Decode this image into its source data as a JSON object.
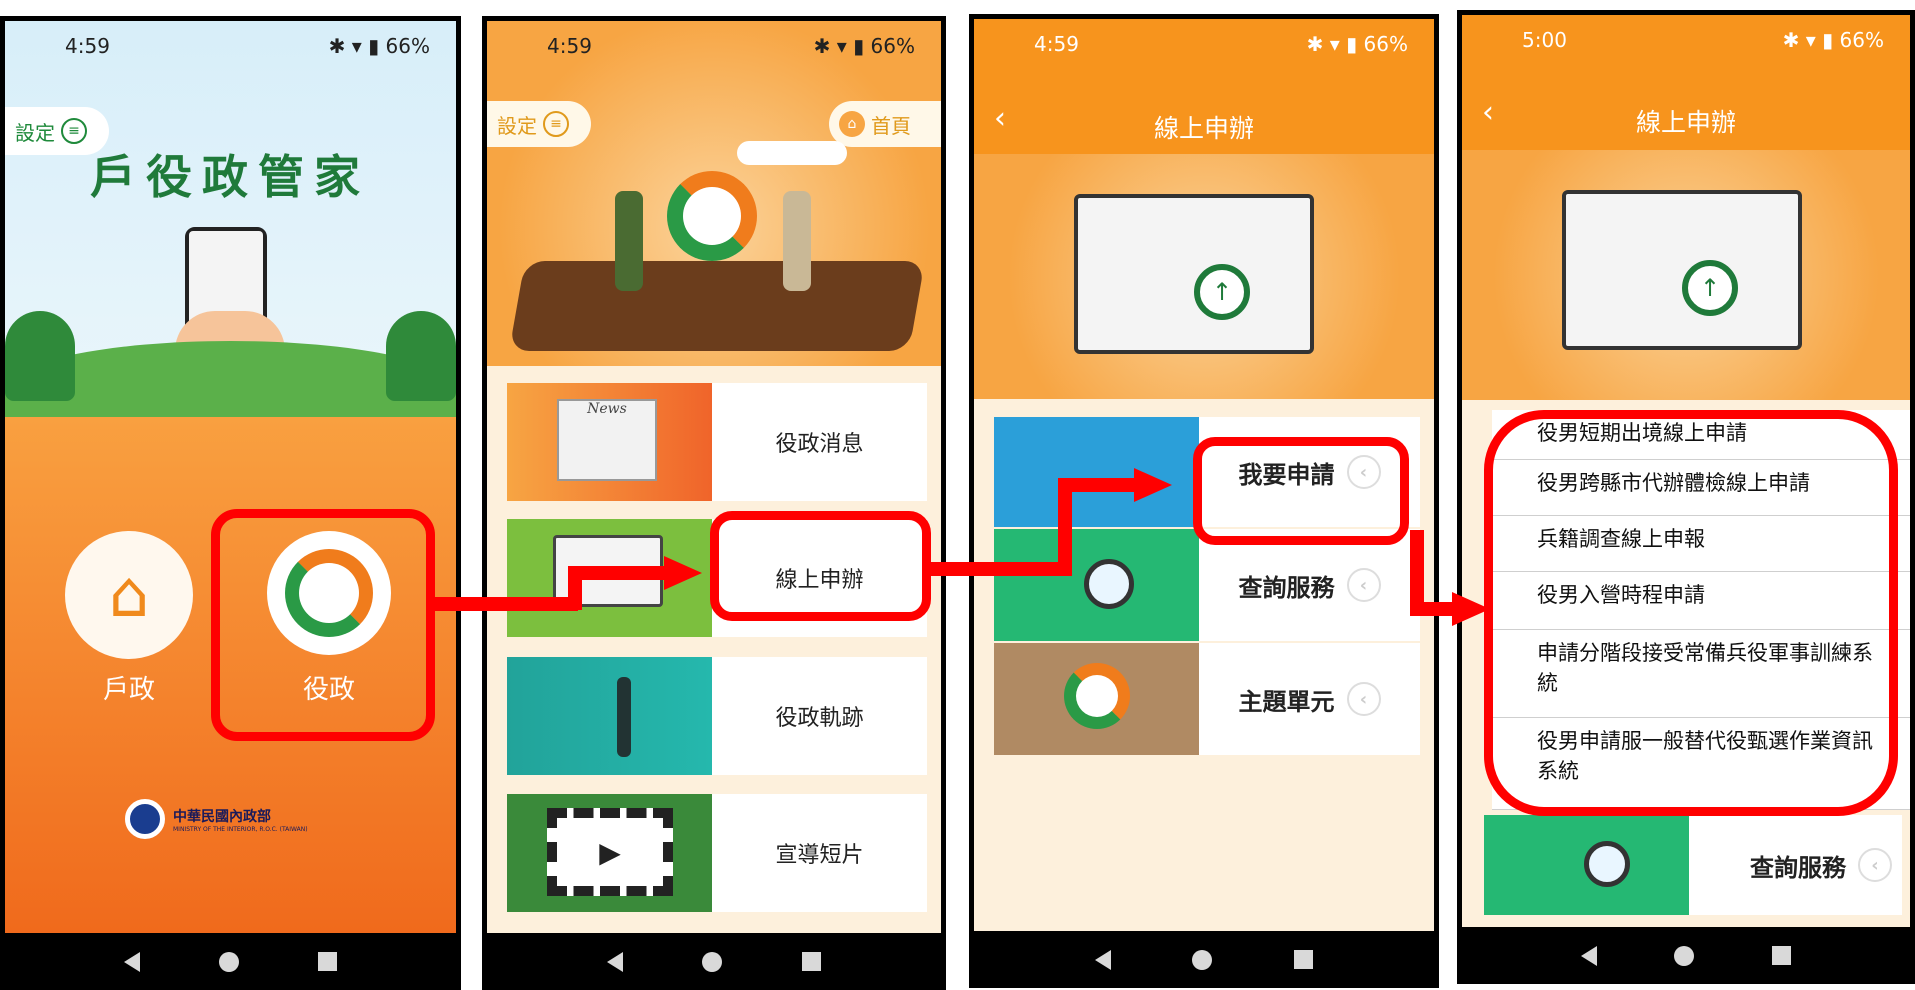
{
  "status": {
    "p1_time": "4:59",
    "p2_time": "4:59",
    "p3_time": "4:59",
    "p4_time": "5:00",
    "battery": "66%"
  },
  "p1": {
    "settings": "設定",
    "title": "戶役政管家",
    "btn_household": "戶政",
    "btn_military": "役政",
    "ministry": "中華民國內政部",
    "ministry_en": "MINISTRY OF THE INTERIOR, R.O.C. (TAIWAN)",
    "ministry_script": "內政部"
  },
  "p2": {
    "settings": "設定",
    "home": "首頁",
    "news_label": "News",
    "items": [
      {
        "label": "役政消息"
      },
      {
        "label": "線上申辦"
      },
      {
        "label": "役政軌跡"
      },
      {
        "label": "宣導短片"
      }
    ]
  },
  "p3": {
    "title": "線上申辦",
    "items": [
      {
        "label": "我要申請"
      },
      {
        "label": "查詢服務"
      },
      {
        "label": "主題單元"
      }
    ]
  },
  "p4": {
    "title": "線上申辦",
    "list": [
      "役男短期出境線上申請",
      "役男跨縣市代辦體檢線上申請",
      "兵籍調查線上申報",
      "役男入營時程申請",
      "申請分階段接受常備兵役軍事訓練系統",
      "役男申請服一般替代役甄選作業資訊系統"
    ],
    "bottom_item": "查詢服務"
  },
  "colors": {
    "orange": "#f7941d",
    "green": "#1f8a3b",
    "red": "#ff0000"
  }
}
